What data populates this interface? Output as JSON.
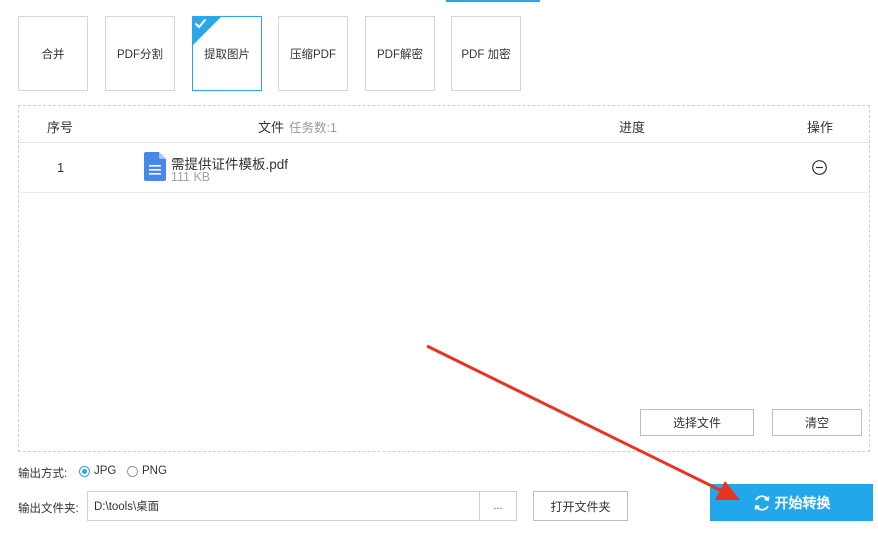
{
  "colors": {
    "accent": "#2aa7e6",
    "start_button": "#22a7ea",
    "annotation": "#e8331e"
  },
  "tool_tabs": [
    {
      "label": "合并"
    },
    {
      "label": "PDF分割"
    },
    {
      "label": "提取图片",
      "active": true
    },
    {
      "label": "压缩PDF"
    },
    {
      "label": "PDF解密"
    },
    {
      "label": "PDF 加密"
    }
  ],
  "table": {
    "headers": {
      "index": "序号",
      "file": "文件",
      "task_count": "任务数:1",
      "progress": "进度",
      "action": "操作"
    },
    "rows": [
      {
        "index": "1",
        "file_name": "需提供证件模板.pdf",
        "file_size": "111 KB",
        "icon": "document-icon",
        "action_icon": "remove-icon"
      }
    ]
  },
  "panel_buttons": {
    "select_files": "选择文件",
    "clear": "清空"
  },
  "output": {
    "format_label": "输出方式:",
    "formats": [
      {
        "label": "JPG",
        "selected": true
      },
      {
        "label": "PNG",
        "selected": false
      }
    ],
    "folder_label": "输出文件夹:",
    "folder_value": "D:\\tools\\桌面",
    "browse_label": "...",
    "open_folder_label": "打开文件夹"
  },
  "start_button": {
    "label": "开始转换",
    "icon": "refresh-icon"
  }
}
